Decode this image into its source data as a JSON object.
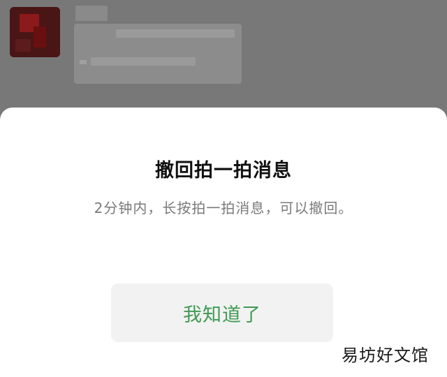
{
  "dialog": {
    "title": "撤回拍一拍消息",
    "description": "2分钟内，长按拍一拍消息，可以撤回。",
    "ok_label": "我知道了"
  },
  "watermark": "易坊好文馆",
  "colors": {
    "overlay": "#7a7a7a",
    "sheet_background": "#ffffff",
    "button_background": "#f2f2f2",
    "button_text": "#3f9a52",
    "title_text": "#111111",
    "description_text": "#7a7a7a"
  }
}
